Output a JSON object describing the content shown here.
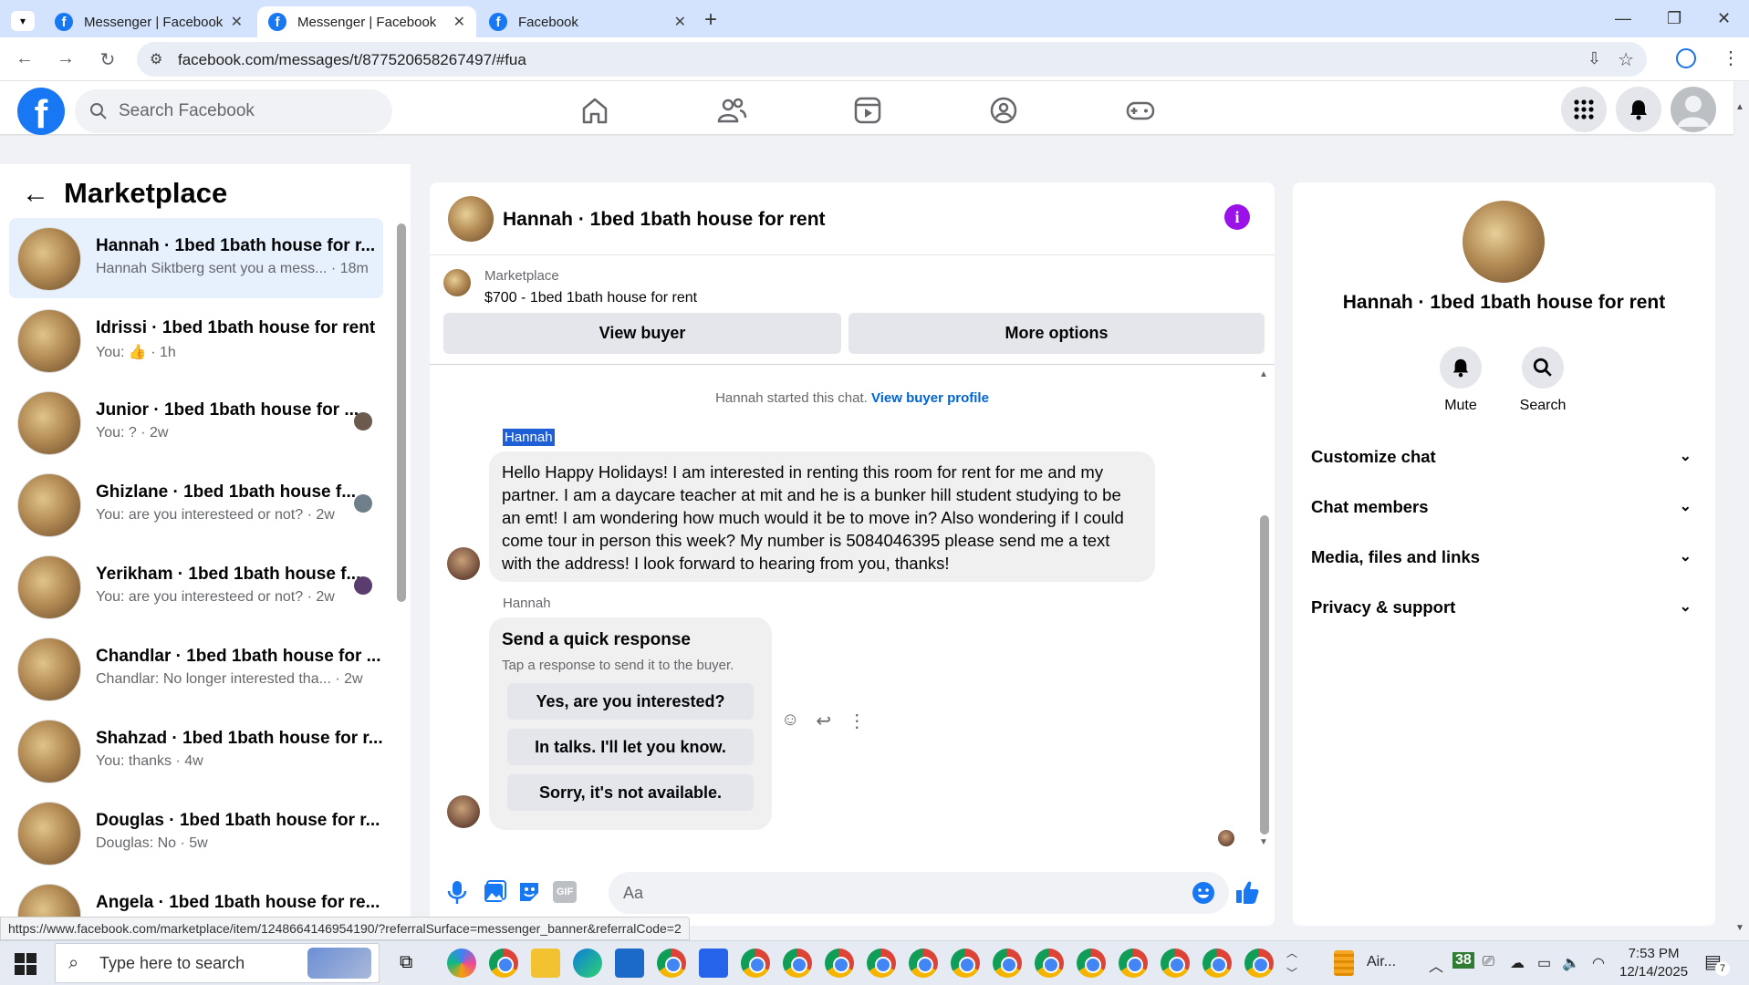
{
  "browser": {
    "tabs": [
      {
        "title": "Messenger | Facebook",
        "active": false
      },
      {
        "title": "Messenger | Facebook",
        "active": true
      },
      {
        "title": "Facebook",
        "active": false
      }
    ],
    "url": "facebook.com/messages/t/877520658267497/#fua",
    "status_url": "https://www.facebook.com/marketplace/item/1248664146954190/?referralSurface=messenger_banner&referralCode=2"
  },
  "fb_header": {
    "logo": "f",
    "search_placeholder": "Search Facebook",
    "nav_icons": [
      "home-icon",
      "friends-icon",
      "video-icon",
      "groups-icon",
      "gaming-icon"
    ],
    "right_icons": [
      "menu-grid-icon",
      "bell-icon",
      "profile-avatar"
    ]
  },
  "sidebar": {
    "title": "Marketplace",
    "conversations": [
      {
        "name": "Hannah · 1bed 1bath house for r...",
        "snippet": "Hannah Siktberg sent you a mess... · 18m",
        "active": true
      },
      {
        "name": "Idrissi · 1bed 1bath house for rent",
        "snippet": "You: 👍 · 1h",
        "active": false
      },
      {
        "name": "Junior · 1bed 1bath house for ...",
        "snippet": "You: ? · 2w",
        "active": false
      },
      {
        "name": "Ghizlane · 1bed 1bath house f...",
        "snippet": "You: are you interesteed or not? · 2w",
        "active": false
      },
      {
        "name": "Yerikham · 1bed 1bath house f...",
        "snippet": "You: are you interesteed or not? · 2w",
        "active": false
      },
      {
        "name": "Chandlar · 1bed 1bath house for ...",
        "snippet": "Chandlar: No longer interested tha... · 2w",
        "active": false
      },
      {
        "name": "Shahzad · 1bed 1bath house for r...",
        "snippet": "You: thanks · 4w",
        "active": false
      },
      {
        "name": "Douglas · 1bed 1bath house for r...",
        "snippet": "Douglas: No · 5w",
        "active": false
      },
      {
        "name": "Angela · 1bed 1bath house for re...",
        "snippet": "",
        "active": false
      }
    ]
  },
  "chat": {
    "title": "Hannah · 1bed 1bath house for rent",
    "banner": {
      "label": "Marketplace",
      "listing": "$700 - 1bed 1bath house for rent",
      "view_buyer": "View buyer",
      "more_options": "More options"
    },
    "started_text": "Hannah started this chat.",
    "view_buyer_profile": "View buyer profile",
    "messages": [
      {
        "sender": "Hannah",
        "text": "Hello Happy Holidays! I am interested in renting this room for rent for me and my partner. I am a daycare teacher at mit and he is a bunker hill student studying to be an emt! I am wondering how much would it be to move in? Also wondering if I could come tour in person this week? My number is 5084046395 please send me a text with the address! I look forward to hearing from you, thanks!"
      }
    ],
    "quick_response": {
      "sender": "Hannah",
      "title": "Send a quick response",
      "subtitle": "Tap a response to send it to the buyer.",
      "options": [
        "Yes, are you interested?",
        "In talks. I'll let you know.",
        "Sorry, it's not available."
      ]
    },
    "composer_placeholder": "Aa"
  },
  "info_panel": {
    "name": "Hannah · 1bed 1bath house for rent",
    "actions": [
      "Mute",
      "Search"
    ],
    "sections": [
      "Customize chat",
      "Chat members",
      "Media, files and links",
      "Privacy & support"
    ]
  },
  "taskbar": {
    "search_placeholder": "Type here to search",
    "weather": "Air...",
    "badge": "38",
    "time": "7:53 PM",
    "date": "12/14/2025",
    "notifications": "7"
  },
  "colors": {
    "fb_blue": "#1877f2",
    "active_conv": "#e7f0fd",
    "info_purple": "#9a12e8",
    "link": "#0064d1"
  }
}
